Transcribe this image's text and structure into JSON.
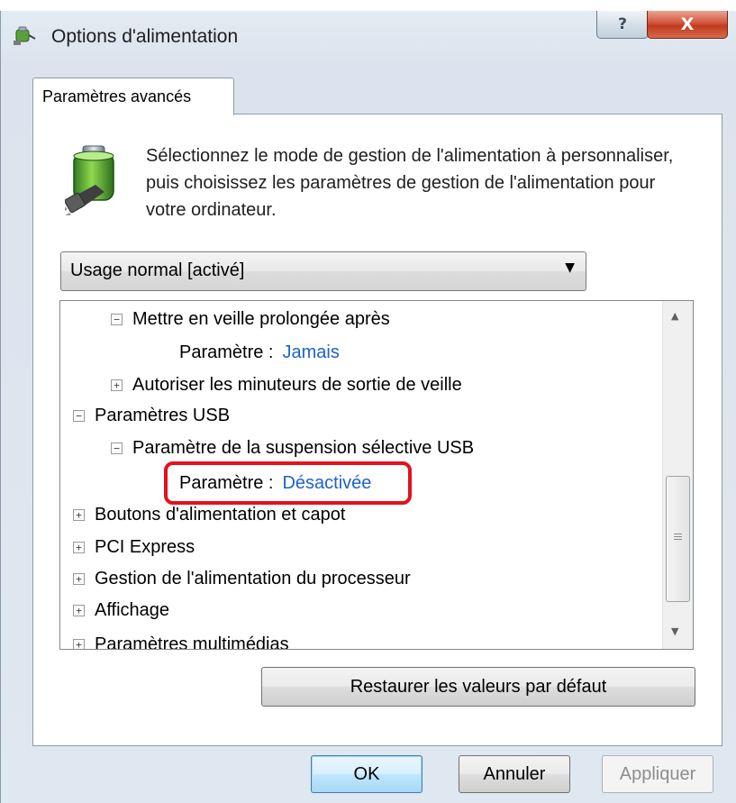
{
  "window": {
    "title": "Options d'alimentation",
    "help_label": "?",
    "close_label": "X"
  },
  "tab": {
    "label": "Paramètres avancés"
  },
  "description": "Sélectionnez le mode de gestion de l'alimentation à personnaliser, puis choisissez les paramètres de gestion de l'alimentation pour votre ordinateur.",
  "plan_dropdown": {
    "selected": "Usage normal [activé]"
  },
  "tree": {
    "rows": [
      {
        "label": "Mettre en veille prolongée après",
        "toggle": "−"
      },
      {
        "label": "Paramètre :",
        "value": "Jamais"
      },
      {
        "label": "Autoriser les minuteurs de sortie de veille",
        "toggle": "+"
      },
      {
        "label": "Paramètres USB",
        "toggle": "−"
      },
      {
        "label": "Paramètre de la suspension sélective USB",
        "toggle": "−"
      },
      {
        "label": "Paramètre :",
        "value": "Désactivée"
      },
      {
        "label": "Boutons d'alimentation et capot",
        "toggle": "+"
      },
      {
        "label": "PCI Express",
        "toggle": "+"
      },
      {
        "label": "Gestion de l'alimentation du processeur",
        "toggle": "+"
      },
      {
        "label": "Affichage",
        "toggle": "+"
      },
      {
        "label": "Paramètres multimédias",
        "toggle": "+"
      }
    ]
  },
  "buttons": {
    "restore": "Restaurer les valeurs par défaut",
    "ok": "OK",
    "cancel": "Annuler",
    "apply": "Appliquer"
  },
  "colors": {
    "setting_value": "#1c62c9",
    "highlight": "#e4121b"
  },
  "icons": [
    "power-plug-icon",
    "battery-plug-icon",
    "dropdown-arrow-icon",
    "scroll-up-icon",
    "scroll-down-icon"
  ]
}
